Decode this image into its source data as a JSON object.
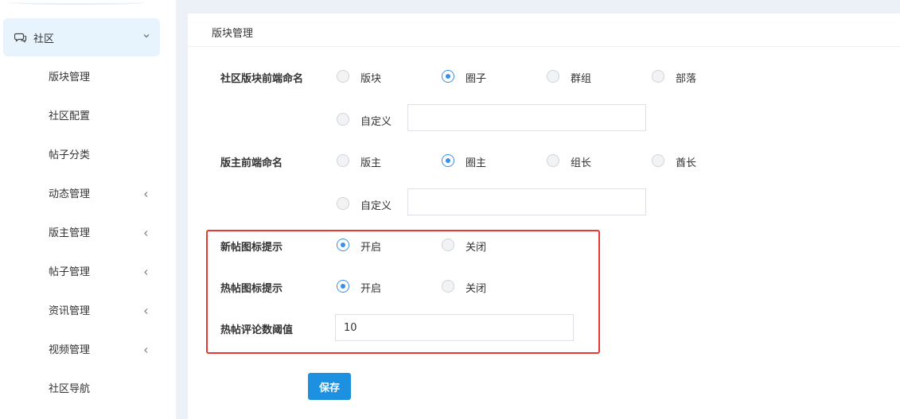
{
  "sidebar": {
    "community": {
      "label": "社区",
      "icon": "chat-bubbles-icon"
    },
    "items": [
      {
        "label": "版块管理",
        "has_chevron": false
      },
      {
        "label": "社区配置",
        "has_chevron": false
      },
      {
        "label": "帖子分类",
        "has_chevron": false
      },
      {
        "label": "动态管理",
        "has_chevron": true
      },
      {
        "label": "版主管理",
        "has_chevron": true
      },
      {
        "label": "帖子管理",
        "has_chevron": true
      },
      {
        "label": "资讯管理",
        "has_chevron": true
      },
      {
        "label": "视频管理",
        "has_chevron": true
      },
      {
        "label": "社区导航",
        "has_chevron": false
      }
    ]
  },
  "panel": {
    "title": "版块管理"
  },
  "form": {
    "block_naming": {
      "label": "社区版块前端命名",
      "options": [
        "版块",
        "圈子",
        "群组",
        "部落"
      ],
      "selected": "圈子",
      "custom_label": "自定义",
      "custom_value": ""
    },
    "moderator_naming": {
      "label": "版主前端命名",
      "options": [
        "版主",
        "圈主",
        "组长",
        "酋长"
      ],
      "selected": "圈主",
      "custom_label": "自定义",
      "custom_value": ""
    },
    "new_post_icon": {
      "label": "新帖图标提示",
      "options": [
        "开启",
        "关闭"
      ],
      "selected": "开启"
    },
    "hot_post_icon": {
      "label": "热帖图标提示",
      "options": [
        "开启",
        "关闭"
      ],
      "selected": "开启"
    },
    "hot_post_threshold": {
      "label": "热帖评论数阈值",
      "value": "10"
    },
    "save_label": "保存"
  },
  "colors": {
    "accent": "#3a8ee6",
    "save_button": "#1e90e0",
    "highlight_border": "#e53935",
    "active_nav_bg": "#e8f4fd",
    "gutter_bg": "#ecf1f7"
  }
}
